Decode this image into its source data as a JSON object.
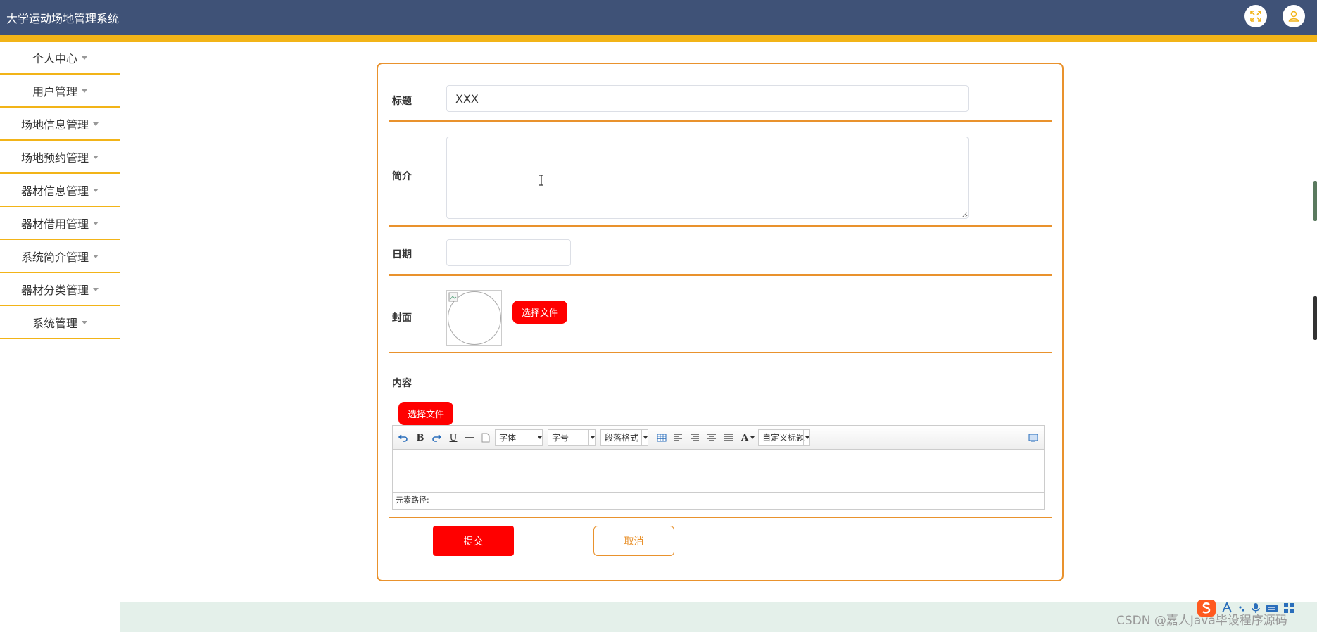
{
  "app": {
    "title": "大学运动场地管理系统"
  },
  "header_icons": [
    "fullscreen-icon",
    "user-icon"
  ],
  "sidebar": {
    "items": [
      {
        "label": "个人中心"
      },
      {
        "label": "用户管理"
      },
      {
        "label": "场地信息管理"
      },
      {
        "label": "场地预约管理"
      },
      {
        "label": "器材信息管理"
      },
      {
        "label": "器材借用管理"
      },
      {
        "label": "系统简介管理"
      },
      {
        "label": "器材分类管理"
      },
      {
        "label": "系统管理"
      }
    ]
  },
  "form": {
    "title_label": "标题",
    "title_value": "XXX",
    "intro_label": "简介",
    "intro_value": "",
    "date_label": "日期",
    "date_value": "",
    "cover_label": "封面",
    "cover_button": "选择文件",
    "content_label": "内容",
    "content_button": "选择文件",
    "submit_label": "提交",
    "cancel_label": "取消"
  },
  "editor": {
    "font_combo": "字体",
    "size_combo": "字号",
    "format_combo": "段落格式",
    "custom_combo": "自定义标题",
    "bold": "B",
    "underline": "U",
    "fontcolor": "A",
    "path_label": "元素路径:"
  },
  "watermark": "CSDN @嘉人Java毕设程序源码",
  "colors": {
    "header": "#3f5277",
    "accent": "#f2b418",
    "border": "#e9922d",
    "primary_button": "#ff0000"
  }
}
